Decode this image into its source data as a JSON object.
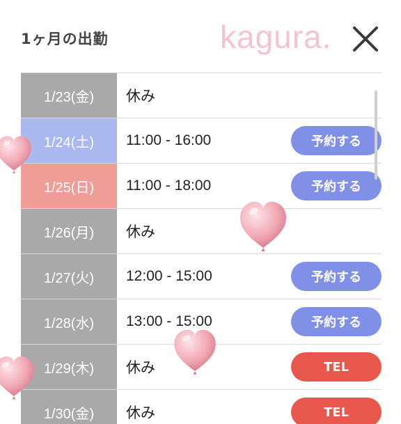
{
  "header": {
    "title": "1ヶ月の出勤",
    "brand": "kagura.",
    "close_icon": "close-icon"
  },
  "schedule": [
    {
      "date": "1/23(金)",
      "hours": "休み",
      "button": "",
      "date_color": "#a9a9a9"
    },
    {
      "date": "1/24(土)",
      "hours": "11:00 - 16:00",
      "button": "予約する",
      "date_color": "#a9b8ef"
    },
    {
      "date": "1/25(日)",
      "hours": "11:00 - 18:00",
      "button": "予約する",
      "date_color": "#ef9d96"
    },
    {
      "date": "1/26(月)",
      "hours": "休み",
      "button": "",
      "date_color": "#a9a9a9"
    },
    {
      "date": "1/27(火)",
      "hours": "12:00 - 15:00",
      "button": "予約する",
      "date_color": "#a9a9a9"
    },
    {
      "date": "1/28(水)",
      "hours": "13:00 - 15:00",
      "button": "予約する",
      "date_color": "#a9a9a9"
    },
    {
      "date": "1/29(木)",
      "hours": "休み",
      "button": "TEL",
      "date_color": "#a9a9a9"
    },
    {
      "date": "1/30(金)",
      "hours": "休み",
      "button": "TEL",
      "date_color": "#a9a9a9"
    }
  ],
  "colors": {
    "reserve_button": "#7f90e6",
    "tel_button": "#e8574b",
    "saturday": "#a9b8ef",
    "sunday": "#ef9d96",
    "weekday": "#a9a9a9"
  }
}
